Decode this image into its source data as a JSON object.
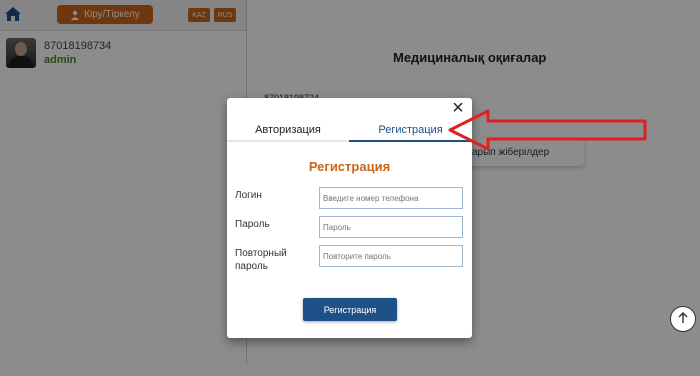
{
  "header": {
    "login_label": "Кіру/Тіркелу",
    "lang_kaz": "KAZ",
    "lang_rus": "RUS"
  },
  "user": {
    "phone": "87018198734",
    "name": "admin"
  },
  "background": {
    "title": "Медициналық оқиғалар",
    "partial_text": "87018198734",
    "card_text": "арып жіберілдер"
  },
  "modal": {
    "tabs": [
      "Авторизация",
      "Регистрация"
    ],
    "title": "Регистрация",
    "fields": [
      {
        "label": "Логин",
        "placeholder": "Введите номер телефона"
      },
      {
        "label": "Пароль",
        "placeholder": "Пароль"
      },
      {
        "label": "Повторный пароль",
        "placeholder": "Повторите пароль"
      }
    ],
    "submit_label": "Регистрация",
    "close_symbol": "×"
  },
  "colors": {
    "accent": "#c8651a",
    "primary": "#1f5189",
    "annotation_arrow": "#e02020"
  },
  "icons": {
    "home": "home-icon",
    "user": "user-icon",
    "close": "close-icon",
    "scroll": "arrow-up-icon"
  }
}
